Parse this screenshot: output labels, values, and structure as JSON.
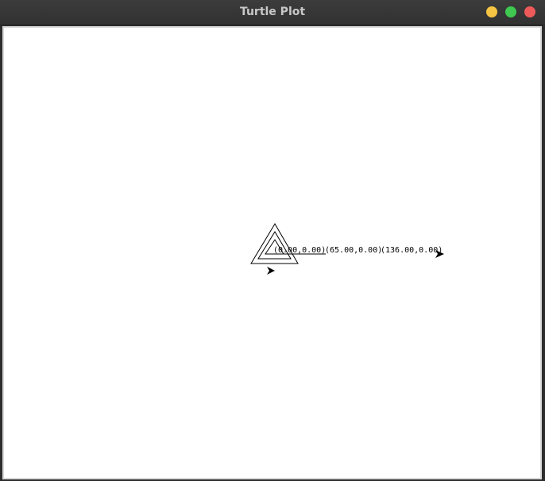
{
  "window": {
    "title": "Turtle Plot"
  },
  "plot": {
    "labels": [
      {
        "text": "(0.00,0.00)"
      },
      {
        "text": "(65.00,0.00)"
      },
      {
        "text": "(136.00,0.00)"
      }
    ]
  },
  "icons": {
    "turtle_cursor": "arrowhead-icon"
  }
}
